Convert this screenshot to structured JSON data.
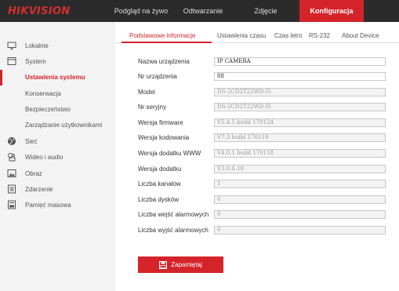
{
  "brand": {
    "logo_text": "HIKVISION",
    "accent_color": "#d5232a"
  },
  "topnav": [
    {
      "label": "Podgląd na żywo"
    },
    {
      "label": "Odtwarzanie"
    },
    {
      "label": "Zdjęcie"
    },
    {
      "label": "Konfiguracja",
      "active": true
    }
  ],
  "sidebar": {
    "items": [
      {
        "label": "Lokalnie",
        "icon": "monitor-icon"
      },
      {
        "label": "System",
        "icon": "system-icon"
      },
      {
        "label": "Ustawienia systemu",
        "active": true
      },
      {
        "label": "Konserwacja"
      },
      {
        "label": "Bezpieczeństwo"
      },
      {
        "label": "Zarządzanie użytkownikami"
      },
      {
        "label": "Sieć",
        "icon": "globe-icon"
      },
      {
        "label": "Wideo i audio",
        "icon": "video-audio-icon"
      },
      {
        "label": "Obraz",
        "icon": "image-icon"
      },
      {
        "label": "Zdarzenie",
        "icon": "event-icon"
      },
      {
        "label": "Pamięć masowa",
        "icon": "storage-icon"
      }
    ]
  },
  "tabs": [
    {
      "label": "Podstawowe informacje",
      "active": true
    },
    {
      "label": "Ustawienia czasu"
    },
    {
      "label": "Czas letni"
    },
    {
      "label": "RS-232"
    },
    {
      "label": "About Device"
    }
  ],
  "form": {
    "rows": [
      {
        "label": "Nazwa urządzenia",
        "value": "IP CAMERA",
        "editable": true
      },
      {
        "label": "Nr urządzenia",
        "value": "88",
        "editable": true
      },
      {
        "label": "Model",
        "value": "DS-2CD2T22WD-I5",
        "editable": false
      },
      {
        "label": "Nr seryjny",
        "value": "DS-2CD2T22WD-I5",
        "editable": false
      },
      {
        "label": "Wersja firmware",
        "value": "V5.4.5 build 170124",
        "editable": false
      },
      {
        "label": "Wersja kodowania",
        "value": "V7.3 build 170119",
        "editable": false
      },
      {
        "label": "Wersja dodatku WWW",
        "value": "V4.0.1 build 170118",
        "editable": false
      },
      {
        "label": "Wersja dodatku",
        "value": "V3.0.6.10",
        "editable": false
      },
      {
        "label": "Liczba kanałów",
        "value": "1",
        "editable": false
      },
      {
        "label": "Liczba dysków",
        "value": "0",
        "editable": false
      },
      {
        "label": "Liczba wejść alarmowych",
        "value": "0",
        "editable": false
      },
      {
        "label": "Liczba wyjść alarmowych",
        "value": "0",
        "editable": false
      }
    ]
  },
  "save_button": {
    "label": "Zapamiętaj",
    "icon": "save-icon"
  }
}
